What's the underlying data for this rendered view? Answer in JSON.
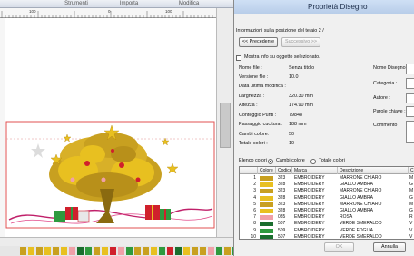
{
  "editor": {
    "tabs": [
      "",
      "Strumenti",
      "Importa",
      "Modifica"
    ],
    "ruler_numbers": [
      "100",
      "0",
      "100"
    ],
    "swatch_colors": [
      "#c8a020",
      "#e8c020",
      "#c8a020",
      "#e8c020",
      "#c8a020",
      "#e8c020",
      "#f0a0a8",
      "#1a6e2e",
      "#2e9a3e",
      "#c8a020",
      "#e8c020",
      "#d0202c",
      "#f0a0a8",
      "#2e9a3e",
      "#c8a020",
      "#c8a020",
      "#e8c020",
      "#2e9a3e",
      "#d0202c",
      "#1a6e2e",
      "#e8c020",
      "#c8a020",
      "#c8a020",
      "#f0a0a8",
      "#2e9a3e",
      "#c8a020",
      "#2e9a3e"
    ]
  },
  "dialog": {
    "title": "Proprietà Disegno",
    "info_text": "Informazioni sulla posizione del telaio 2 /",
    "prev_button": "<< Precedente",
    "next_button": "Successivo >>",
    "show_info_label": "Mostra info su oggetto selezionato.",
    "props": [
      {
        "label": "Nome file :",
        "value": "Senza titolo"
      },
      {
        "label": "Versione file :",
        "value": "10.0"
      },
      {
        "label": "Data ultima modifica :",
        "value": ""
      },
      {
        "label": "Larghezza :",
        "value": "320.30 mm"
      },
      {
        "label": "Altezza :",
        "value": "174.90 mm"
      },
      {
        "label": "Conteggio Punti :",
        "value": "79848"
      },
      {
        "label": "Passaggio cucitura :",
        "value": "188 mm"
      },
      {
        "label": "Cambi colore:",
        "value": "50"
      },
      {
        "label": "Totale colori :",
        "value": "10"
      }
    ],
    "fields": [
      "Nome Disegno :",
      "Categoria :",
      "Autore :",
      "Parole chiave :",
      "Commento :"
    ],
    "color_list_label": "Elenco colori",
    "radio_changes": "Cambi colore",
    "radio_total": "Totale colori",
    "table": {
      "headers": [
        "",
        "Colore",
        "Codice",
        "Marca",
        "Descrizione",
        "C"
      ],
      "rows": [
        {
          "num": "1",
          "color": "#c8a020",
          "code": "323",
          "brand": "EMBROIDERY",
          "desc": "MARRONE CHIARO",
          "c": "M"
        },
        {
          "num": "2",
          "color": "#e8c020",
          "code": "328",
          "brand": "EMBROIDERY",
          "desc": "GIALLO AMBRA",
          "c": "G"
        },
        {
          "num": "3",
          "color": "#c8a020",
          "code": "323",
          "brand": "EMBROIDERY",
          "desc": "MARRONE CHIARO",
          "c": "M"
        },
        {
          "num": "4",
          "color": "#e8c020",
          "code": "328",
          "brand": "EMBROIDERY",
          "desc": "GIALLO AMBRA",
          "c": "G"
        },
        {
          "num": "5",
          "color": "#c8a020",
          "code": "323",
          "brand": "EMBROIDERY",
          "desc": "MARRONE CHIARO",
          "c": "M"
        },
        {
          "num": "6",
          "color": "#e8c020",
          "code": "328",
          "brand": "EMBROIDERY",
          "desc": "GIALLO AMBRA",
          "c": "G"
        },
        {
          "num": "7",
          "color": "#f0a0a8",
          "code": "085",
          "brand": "EMBROIDERY",
          "desc": "ROSA",
          "c": "R"
        },
        {
          "num": "8",
          "color": "#1a6e2e",
          "code": "507",
          "brand": "EMBROIDERY",
          "desc": "VERDE SMERALDO",
          "c": "V"
        },
        {
          "num": "9",
          "color": "#2e9a3e",
          "code": "509",
          "brand": "EMBROIDERY",
          "desc": "VERDE FOGLIA",
          "c": "V"
        },
        {
          "num": "10",
          "color": "#1a6e2e",
          "code": "507",
          "brand": "EMBROIDERY",
          "desc": "VERDE SMERALDO",
          "c": "V"
        }
      ]
    },
    "ok_button": "OK",
    "cancel_button": "Annulla"
  }
}
